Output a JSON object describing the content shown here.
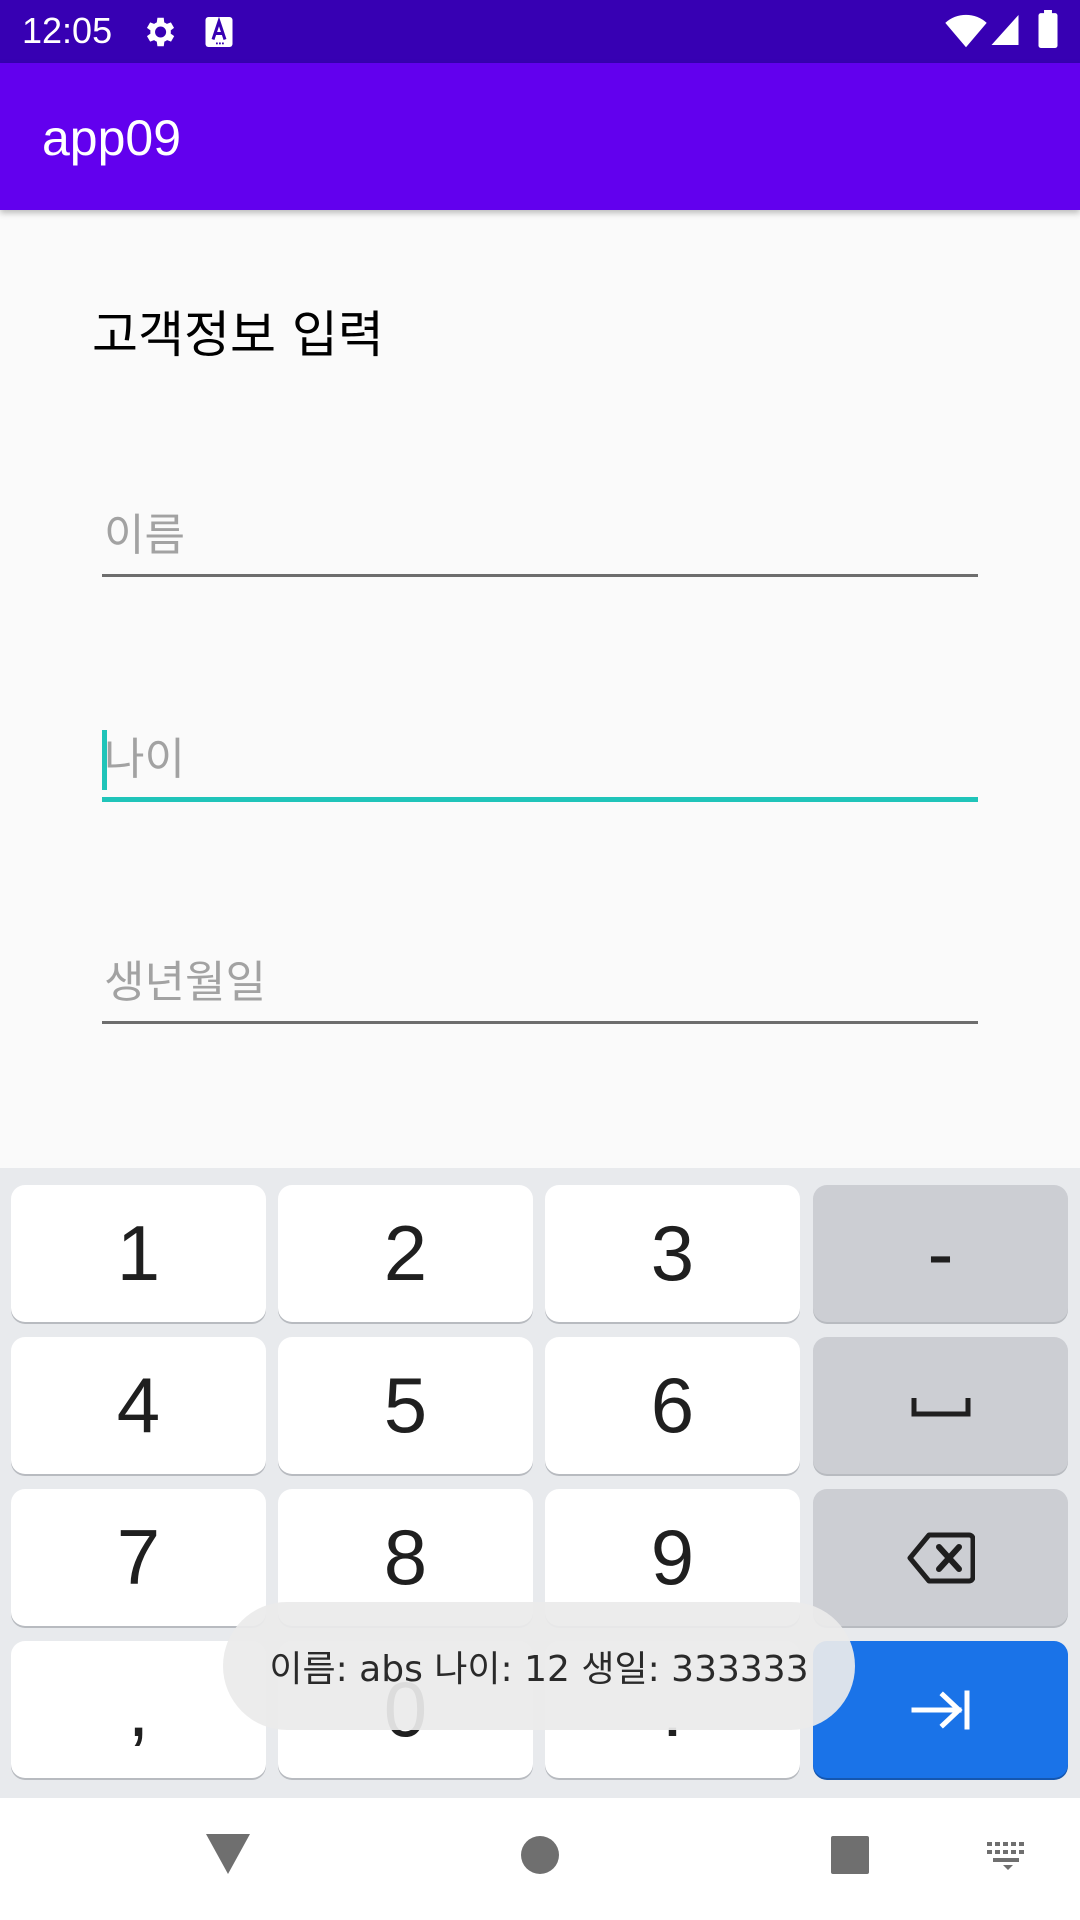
{
  "status_bar": {
    "time": "12:05",
    "icons": [
      "gear-icon",
      "keyboard-a-icon",
      "wifi-icon",
      "signal-icon",
      "battery-icon"
    ]
  },
  "app_bar": {
    "title": "app09",
    "color": "#6200ee",
    "status_color": "#3700b3"
  },
  "form": {
    "heading": "고객정보 입력",
    "fields": [
      {
        "placeholder": "이름",
        "value": ""
      },
      {
        "placeholder": "나이",
        "value": "",
        "focused": true
      },
      {
        "placeholder": "생년월일",
        "value": ""
      }
    ],
    "accent_color": "#1fc4b9"
  },
  "keyboard": {
    "keys": {
      "k1": "1",
      "k2": "2",
      "k3": "3",
      "minus": "-",
      "k4": "4",
      "k5": "5",
      "k6": "6",
      "k7": "7",
      "k8": "8",
      "k9": "9",
      "comma": ",",
      "k0": "0",
      "period": "."
    },
    "icons": [
      "space-icon",
      "backspace-icon",
      "tab-next-icon"
    ],
    "action_color": "#1a73e8"
  },
  "toast": {
    "message": "이름: abs 나이: 12 생일: 333333"
  },
  "nav_bar": {
    "icons": [
      "back-icon",
      "home-icon",
      "recents-icon",
      "keyboard-switch-icon"
    ]
  }
}
